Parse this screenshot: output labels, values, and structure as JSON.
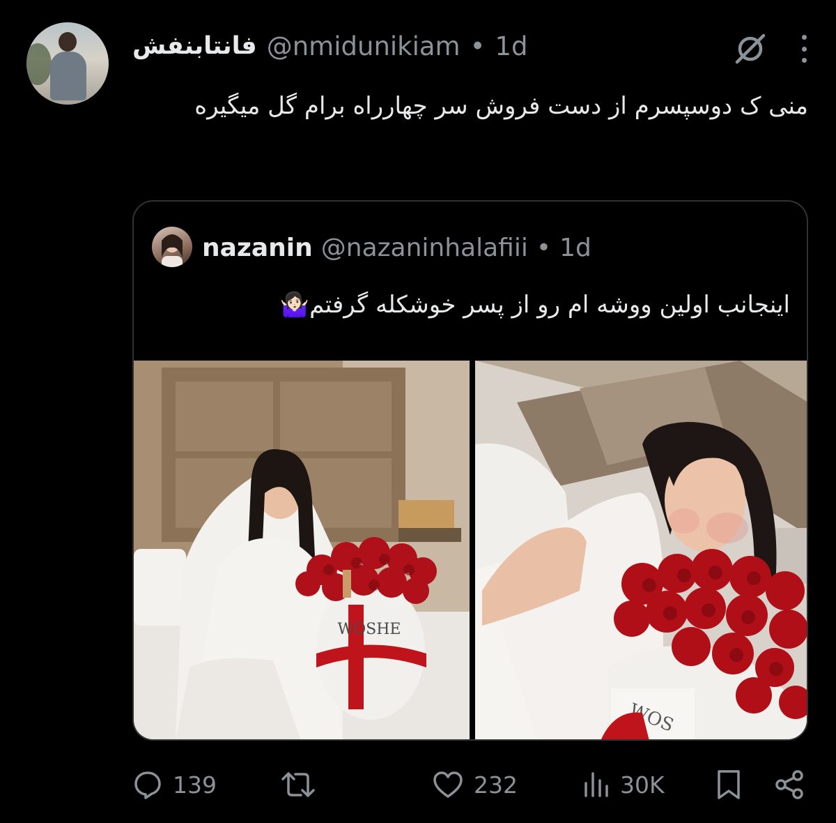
{
  "author": {
    "display_name": "فانتابنفش",
    "handle": "@nmidunikiam",
    "time": "1d"
  },
  "tweet": {
    "text": "منی ک دوسپسرم از دست فروش سر چهارراه برام گل میگیره"
  },
  "quoted": {
    "display_name": "nazanin",
    "handle": "@nazaninhalafiii",
    "time": "1d",
    "text": "اینجانب اولین ووشه ام رو از پسر خوشکله گرفتم🤷🏻‍♀️",
    "images": [
      {
        "box_label": "WOSHE"
      },
      {
        "box_label": "WOS"
      }
    ]
  },
  "separator": "•",
  "metrics": {
    "replies": "139",
    "likes": "232",
    "views": "30K"
  },
  "icons": {
    "reply": "comment-bubble-icon",
    "retweet": "retweet-icon",
    "like": "heart-icon",
    "views": "bar-chart-icon",
    "bookmark": "bookmark-icon",
    "share": "share-icon",
    "grok": "grok-icon",
    "more": "more-vertical-icon"
  },
  "colors": {
    "background": "#000000",
    "text": "#e7e9ea",
    "secondary": "#8b9298",
    "border": "#2f3336",
    "rose": "#c0141c"
  }
}
